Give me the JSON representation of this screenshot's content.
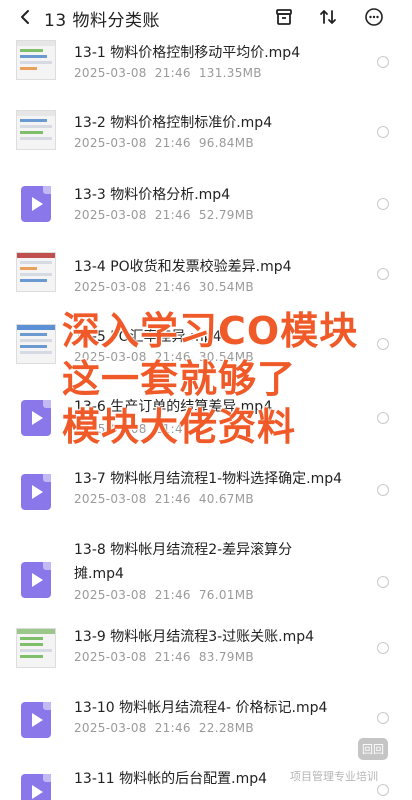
{
  "header": {
    "title": "13 物料分类账",
    "back_icon": "chevron-left-icon",
    "icons": [
      "box-icon",
      "sort-icon",
      "more-icon"
    ]
  },
  "files": [
    {
      "name": "13-1 物料价格控制移动平均价.mp4",
      "date": "2025-03-08",
      "time": "21:46",
      "size": "131.35MB",
      "thumb": "image"
    },
    {
      "name": "13-2 物料价格控制标准价.mp4",
      "date": "2025-03-08",
      "time": "21:46",
      "size": "96.84MB",
      "thumb": "image"
    },
    {
      "name": "13-3 物料价格分析.mp4",
      "date": "2025-03-08",
      "time": "21:46",
      "size": "52.79MB",
      "thumb": "video"
    },
    {
      "name": "13-4 PO收货和发票校验差异.mp4",
      "date": "2025-03-08",
      "time": "21:46",
      "size": "30.54MB",
      "thumb": "image"
    },
    {
      "name": "13-5 PO汇率差异.mp4",
      "date": "2025-03-08",
      "time": "21:46",
      "size": "30.54MB",
      "thumb": "image"
    },
    {
      "name": "13-6 生产订单的结算差异.mp4",
      "date": "2025-03-08",
      "time": "21:46",
      "size": "",
      "thumb": "video"
    },
    {
      "name": "13-7 物料帐月结流程1-物料选择确定.mp4",
      "date": "2025-03-08",
      "time": "21:46",
      "size": "40.67MB",
      "thumb": "video"
    },
    {
      "name": "13-8 物料帐月结流程2-差异滚算分摊.mp4",
      "date": "2025-03-08",
      "time": "21:46",
      "size": "76.01MB",
      "thumb": "video"
    },
    {
      "name": "13-9 物料帐月结流程3-过账关账.mp4",
      "date": "2025-03-08",
      "time": "21:46",
      "size": "83.79MB",
      "thumb": "image"
    },
    {
      "name": "13-10 物料帐月结流程4- 价格标记.mp4",
      "date": "2025-03-08",
      "time": "21:46",
      "size": "22.28MB",
      "thumb": "video"
    },
    {
      "name": "13-11 物料帐的后台配置.mp4",
      "date": "",
      "time": "",
      "size": "",
      "thumb": "video"
    }
  ],
  "overlay": {
    "line1": "深入学习CO模块",
    "line2": "这一套就够了",
    "line3": "模块大佬资料",
    "color": "#f05a28"
  },
  "floating_badge": "回回",
  "watermark": "项目管理专业培训"
}
